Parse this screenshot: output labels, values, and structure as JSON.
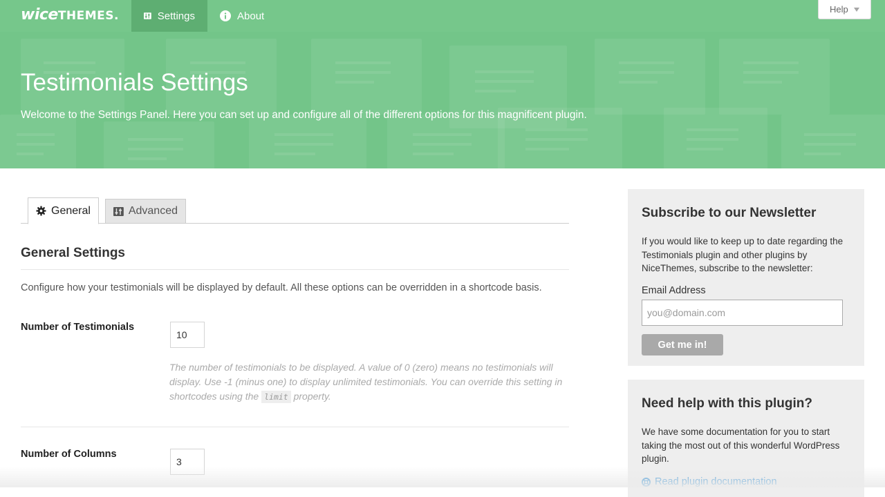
{
  "brand": {
    "logo_part1": "wice",
    "logo_part2": "THEMES."
  },
  "nav": {
    "settings_label": "Settings",
    "about_label": "About",
    "help_label": "Help"
  },
  "hero": {
    "title": "Testimonials Settings",
    "subtitle": "Welcome to the Settings Panel. Here you can set up and configure all of the different options for this magnificent plugin."
  },
  "tabs": [
    {
      "label": "General",
      "icon": "gear-icon",
      "active": true
    },
    {
      "label": "Advanced",
      "icon": "sliders-icon",
      "active": false
    }
  ],
  "main": {
    "section_title": "General Settings",
    "section_desc": "Configure how your testimonials will be displayed by default. All these options can be overridden in a shortcode basis.",
    "fields": [
      {
        "label": "Number of Testimonials",
        "value": "10",
        "help_before": "The number of testimonials to be displayed. A value of 0 (zero) means no testimonials will display. Use -1 (minus one) to display unlimited testimonials. You can override this setting in shortcodes using the",
        "help_code": "limit",
        "help_after": "property."
      },
      {
        "label": "Number of Columns",
        "value": "3"
      }
    ]
  },
  "sidebar": {
    "newsletter": {
      "title": "Subscribe to our Newsletter",
      "text": "If you would like to keep up to date regarding the Testimonials plugin and other plugins by NiceThemes, subscribe to the newsletter:",
      "email_label": "Email Address",
      "email_placeholder": "you@domain.com",
      "button_label": "Get me in!"
    },
    "help": {
      "title": "Need help with this plugin?",
      "text": "We have some documentation for you to start taking the most out of this wonderful WordPress plugin.",
      "link_label": "Read plugin documentation"
    }
  },
  "colors": {
    "brand_green": "#76c78b",
    "active_nav_green": "#5eae72",
    "link_blue": "#3a94d5"
  }
}
